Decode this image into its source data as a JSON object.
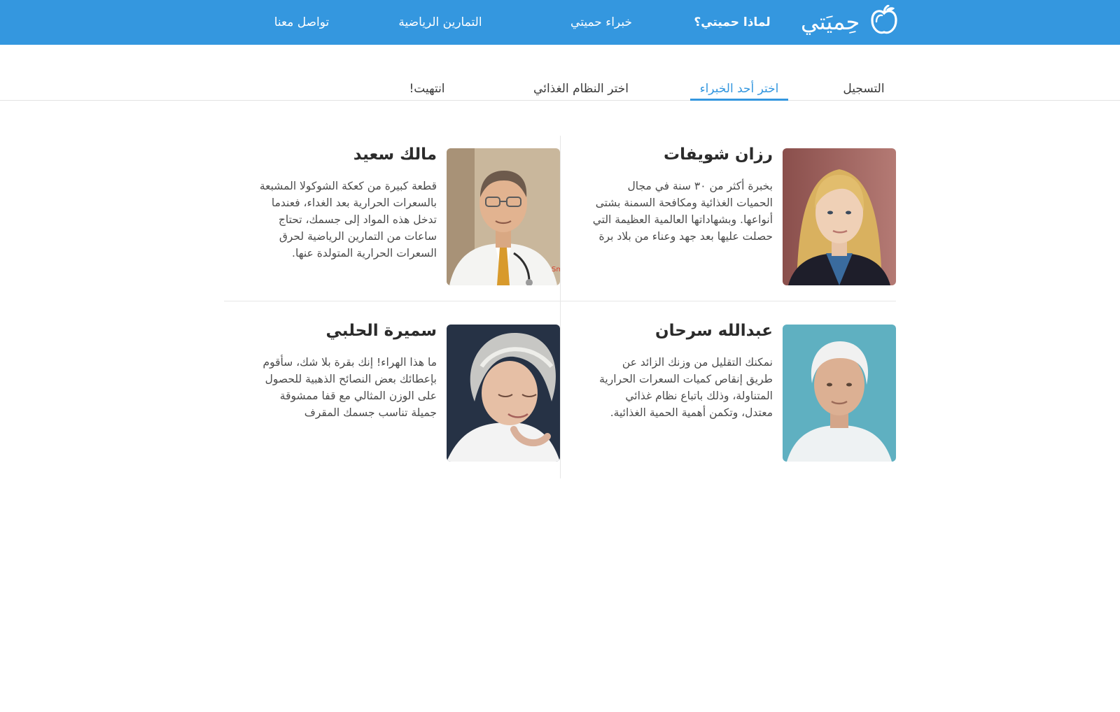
{
  "header": {
    "logo_text": "حِميَتي",
    "logo_icon": "apple-icon",
    "nav": [
      {
        "label": "لماذا حميتي؟"
      },
      {
        "label": "خبراء حميتي"
      },
      {
        "label": "التمارين الرياضية"
      },
      {
        "label": "تواصل معنا"
      }
    ]
  },
  "steps": [
    {
      "label": "التسجيل",
      "state": "done"
    },
    {
      "label": "اختر أحد الخبراء",
      "state": "active"
    },
    {
      "label": "اختر النظام الغذائي",
      "state": "pending"
    },
    {
      "label": "انتهيت!",
      "state": "pending"
    }
  ],
  "experts": [
    {
      "name": "رزان شويفات",
      "bio": "بخبرة أكثر من ٣٠ سنة في مجال الحميات الغذائية ومكافحة السمنة بشتى أنواعها. وبشهاداتها العالمية العظيمة التي حصلت عليها بعد جهد وعناء من بلاد برة",
      "photo": "woman-blonde-portrait"
    },
    {
      "name": "مالك سعيد",
      "bio": "قطعة كبيرة من كعكة الشوكولا المشبعة بالسعرات الحرارية بعد الغداء، فعندما تدخل هذه المواد إلى جسمك، تحتاج ساعات من التمارين الرياضية لحرق السعرات الحرارية المتولدة عنها.",
      "photo": "doctor-with-stethoscope-portrait",
      "photo_caption": "SmartForL"
    },
    {
      "name": "عبدالله سرحان",
      "bio": "نمكنك التقليل من وزنك الزائد عن طريق إنقاص كميات السعرات الحرارية المتناولة، وذلك باتباع نظام غذائي معتدل، وتكمن أهمية الحمية الغذائية.",
      "photo": "white-haired-man-portrait"
    },
    {
      "name": "سميرة الحلبي",
      "bio": "ما هذا الهراء! إنك بقرة بلا شك، سأقوم بإعطائك بعض النصائح الذهبية للحصول على الوزن المثالي مع قفا ممشوقة جميلة تناسب جسمك المقرف",
      "photo": "grey-haired-woman-portrait"
    }
  ],
  "colors": {
    "brand": "#3497df",
    "text": "#2b2b2b",
    "divider": "#e6e6e6"
  }
}
